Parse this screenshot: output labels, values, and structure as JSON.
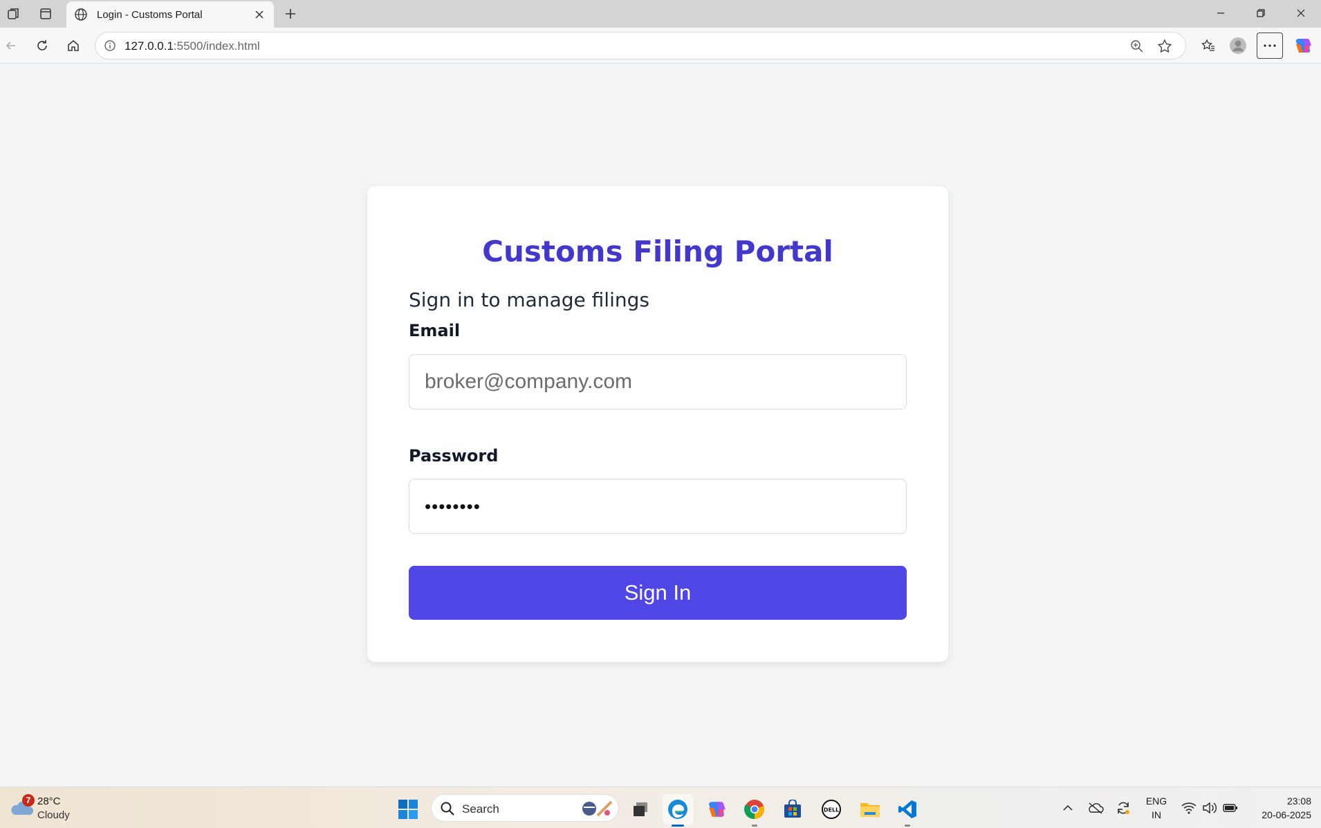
{
  "browser": {
    "tab_title": "Login - Customs Portal",
    "url_host": "127.0.0.1",
    "url_rest": ":5500/index.html"
  },
  "page": {
    "title": "Customs Filing Portal",
    "subtitle": "Sign in to manage filings",
    "email_label": "Email",
    "email_placeholder": "broker@company.com",
    "password_label": "Password",
    "password_value": "••••••••",
    "signin_label": "Sign In",
    "accent_color": "#4338ca",
    "button_color": "#4f46e5"
  },
  "taskbar": {
    "weather_badge": "7",
    "weather_temp": "28°C",
    "weather_condition": "Cloudy",
    "search_label": "Search",
    "lang_line1": "ENG",
    "lang_line2": "IN",
    "time": "23:08",
    "date": "20-06-2025"
  }
}
